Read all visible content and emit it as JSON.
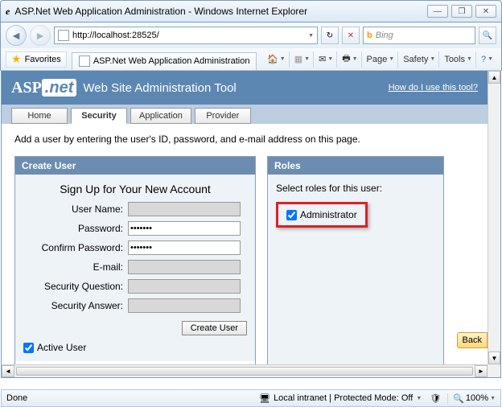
{
  "window": {
    "title": "ASP.Net Web Application Administration - Windows Internet Explorer"
  },
  "nav": {
    "url": "http://localhost:28525/",
    "search_placeholder": "Bing"
  },
  "favorites": {
    "label": "Favorites",
    "tab_title": "ASP.Net Web Application Administration"
  },
  "cmdbar": {
    "page": "Page",
    "safety": "Safety",
    "tools": "Tools"
  },
  "banner": {
    "logo_left": "ASP",
    "logo_right": ".net",
    "subtitle": "Web Site Administration Tool",
    "help_link": "How do I use this tool?"
  },
  "tabs": {
    "home": "Home",
    "security": "Security",
    "application": "Application",
    "provider": "Provider"
  },
  "instruction": "Add a user by entering the user's ID, password, and e-mail address on this page.",
  "create_user": {
    "header": "Create User",
    "signup_title": "Sign Up for Your New Account",
    "labels": {
      "username": "User Name:",
      "password": "Password:",
      "confirm": "Confirm Password:",
      "email": "E-mail:",
      "question": "Security Question:",
      "answer": "Security Answer:"
    },
    "password_value": "•••••••",
    "confirm_value": "•••••••",
    "button": "Create User",
    "active_user": "Active User"
  },
  "roles": {
    "header": "Roles",
    "prompt": "Select roles for this user:",
    "role_name": "Administrator"
  },
  "back_button": "Back",
  "status": {
    "done": "Done",
    "zone": "Local intranet | Protected Mode: Off",
    "zoom": "100%"
  }
}
